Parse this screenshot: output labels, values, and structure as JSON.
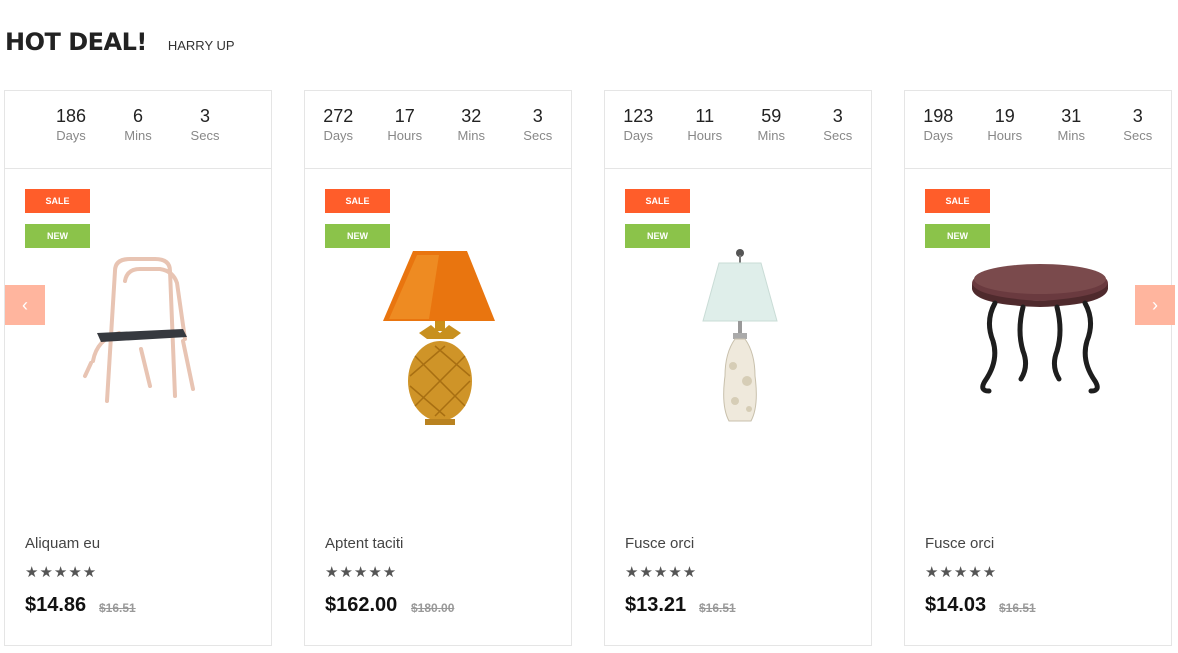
{
  "header": {
    "title": "HOT DEAL!",
    "subtitle": "HARRY UP"
  },
  "nav": {
    "prev_icon": "‹",
    "next_icon": "›"
  },
  "products": [
    {
      "countdown": [
        {
          "value": "186",
          "label": "Days"
        },
        {
          "value": "6",
          "label": "Mins"
        },
        {
          "value": "3",
          "label": "Secs"
        }
      ],
      "badges": {
        "sale": "SALE",
        "new": "NEW"
      },
      "image_icon": "chair-icon",
      "name": "Aliquam eu",
      "stars": "★★★★★",
      "price": "$14.86",
      "old_price": "$16.51"
    },
    {
      "countdown": [
        {
          "value": "272",
          "label": "Days"
        },
        {
          "value": "17",
          "label": "Hours"
        },
        {
          "value": "32",
          "label": "Mins"
        },
        {
          "value": "3",
          "label": "Secs"
        }
      ],
      "badges": {
        "sale": "SALE",
        "new": "NEW"
      },
      "image_icon": "table-lamp-icon",
      "name": "Aptent taciti",
      "stars": "★★★★★",
      "price": "$162.00",
      "old_price": "$180.00"
    },
    {
      "countdown": [
        {
          "value": "123",
          "label": "Days"
        },
        {
          "value": "11",
          "label": "Hours"
        },
        {
          "value": "59",
          "label": "Mins"
        },
        {
          "value": "3",
          "label": "Secs"
        }
      ],
      "badges": {
        "sale": "SALE",
        "new": "NEW"
      },
      "image_icon": "vase-lamp-icon",
      "name": "Fusce orci",
      "stars": "★★★★★",
      "price": "$13.21",
      "old_price": "$16.51"
    },
    {
      "countdown": [
        {
          "value": "198",
          "label": "Days"
        },
        {
          "value": "19",
          "label": "Hours"
        },
        {
          "value": "31",
          "label": "Mins"
        },
        {
          "value": "3",
          "label": "Secs"
        }
      ],
      "badges": {
        "sale": "SALE",
        "new": "NEW"
      },
      "image_icon": "side-table-icon",
      "name": "Fusce orci",
      "stars": "★★★★★",
      "price": "$14.03",
      "old_price": "$16.51"
    }
  ],
  "colors": {
    "sale": "#ff5d2a",
    "new": "#8bc34a",
    "nav": "#ffb59e"
  }
}
